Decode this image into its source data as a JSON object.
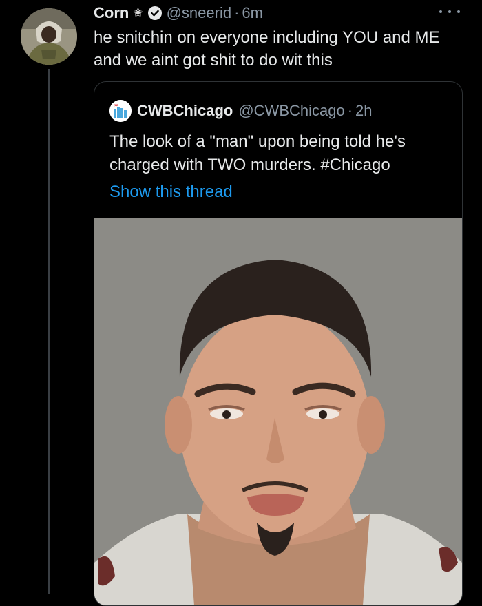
{
  "tweet": {
    "author_name": "Corn",
    "author_handle": "@sneerid",
    "time": "6m",
    "separator": "·",
    "text": "he snitchin on everyone including YOU and ME and we aint got shit to do wit this",
    "icons": [
      "star-icon",
      "verified-icon",
      "more-icon"
    ]
  },
  "quoted_tweet": {
    "author_name": "CWBChicago",
    "author_handle": "@CWBChicago",
    "time": "2h",
    "separator": "·",
    "text": "The look of a \"man\" upon being told he's charged with TWO murders. #Chicago",
    "show_thread_label": "Show this thread",
    "link_color": "#1d9bf0"
  },
  "colors": {
    "background": "#000000",
    "primary_text": "#e7e9ea",
    "secondary_text": "#8b98a5",
    "border": "#2f3336"
  }
}
